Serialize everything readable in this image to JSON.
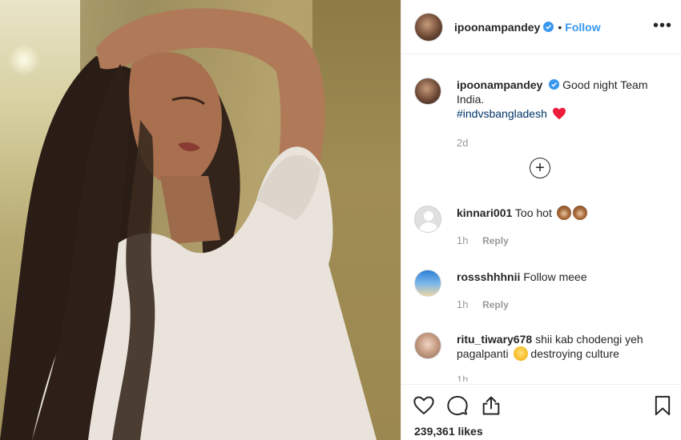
{
  "post": {
    "username": "ipoonampandey",
    "follow_label": "Follow",
    "dot": "•",
    "more_label": "•••"
  },
  "caption": {
    "username": "ipoonampandey",
    "text": "Good night Team India.",
    "hashtag": "#indvsbangladesh",
    "time": "2d"
  },
  "load_more_label": "+",
  "comments": [
    {
      "username": "kinnari001",
      "text": "Too hot",
      "time": "1h",
      "reply_label": "Reply"
    },
    {
      "username": "rossshhhnii",
      "text": "Follow meee",
      "time": "1h",
      "reply_label": "Reply"
    },
    {
      "username": "ritu_tiwary678",
      "text": "shii kab chodengi yeh pagalpanti",
      "text_after": "destroying culture",
      "time": "1h"
    }
  ],
  "likes_label": "239,361 likes",
  "colors": {
    "link": "#3897f0",
    "hashtag": "#003569",
    "heart": "#ed4956",
    "verified": "#3897f0"
  },
  "icons": [
    "verified-badge-icon",
    "heart-icon",
    "comment-icon",
    "share-icon",
    "bookmark-icon",
    "add-circle-icon",
    "red-heart-emoji",
    "monkey-emoji",
    "sad-face-emoji"
  ]
}
